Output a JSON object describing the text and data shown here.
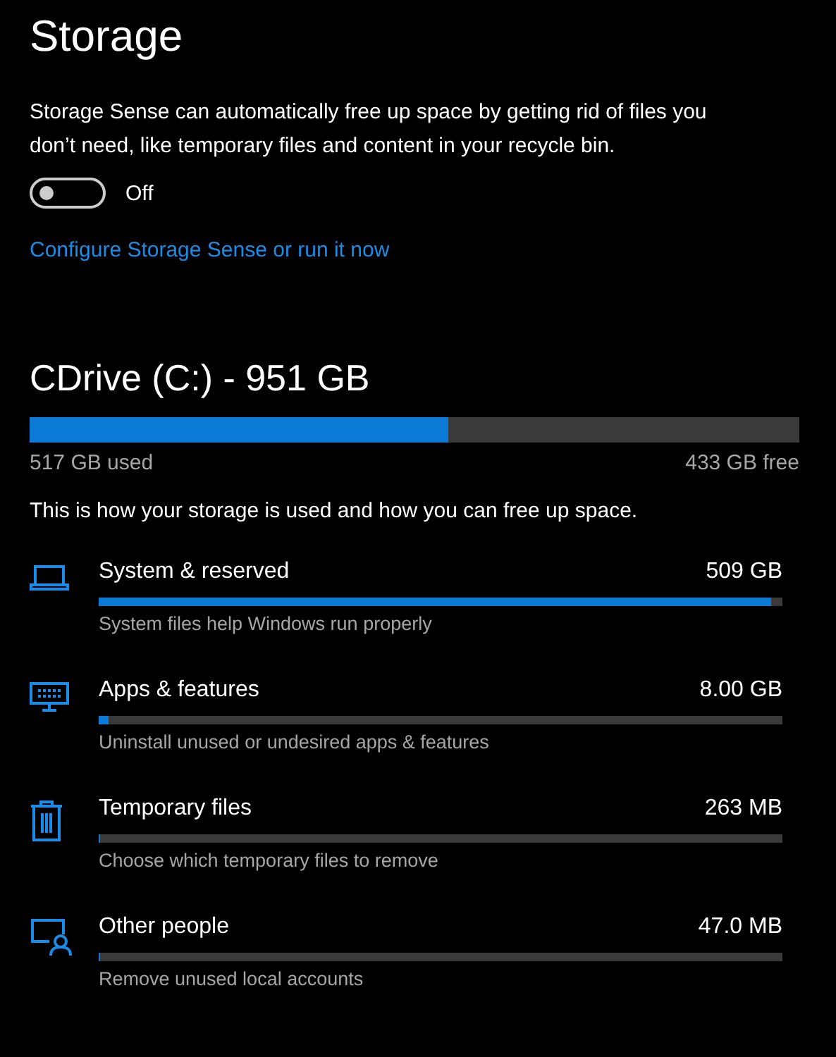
{
  "title": "Storage",
  "storage_sense": {
    "description": "Storage Sense can automatically free up space by getting rid of files you don’t need, like temporary files and content in your recycle bin.",
    "toggle": {
      "on": false,
      "label": "Off"
    },
    "link": "Configure Storage Sense or run it now"
  },
  "drive": {
    "name": "CDrive (C:) - 951 GB",
    "level": 0.544,
    "used": "517 GB used",
    "free": "433 GB free"
  },
  "info": "This is how your storage is used and how you can free up space.",
  "categories": [
    {
      "kind": "laptop",
      "name": "System & reserved",
      "size": "509 GB",
      "level": 0.984,
      "description": "System files help Windows run properly"
    },
    {
      "kind": "apps",
      "name": "Apps & features",
      "size": "8.00 GB",
      "level": 0.015,
      "description": "Uninstall unused or undesired apps & features"
    },
    {
      "kind": "trash",
      "name": "Temporary files",
      "size": "263 MB",
      "level": 0.0005,
      "description": "Choose which temporary files to remove"
    },
    {
      "kind": "people",
      "name": "Other people",
      "size": "47.0 MB",
      "level": 0.0001,
      "description": "Remove unused local accounts"
    }
  ]
}
